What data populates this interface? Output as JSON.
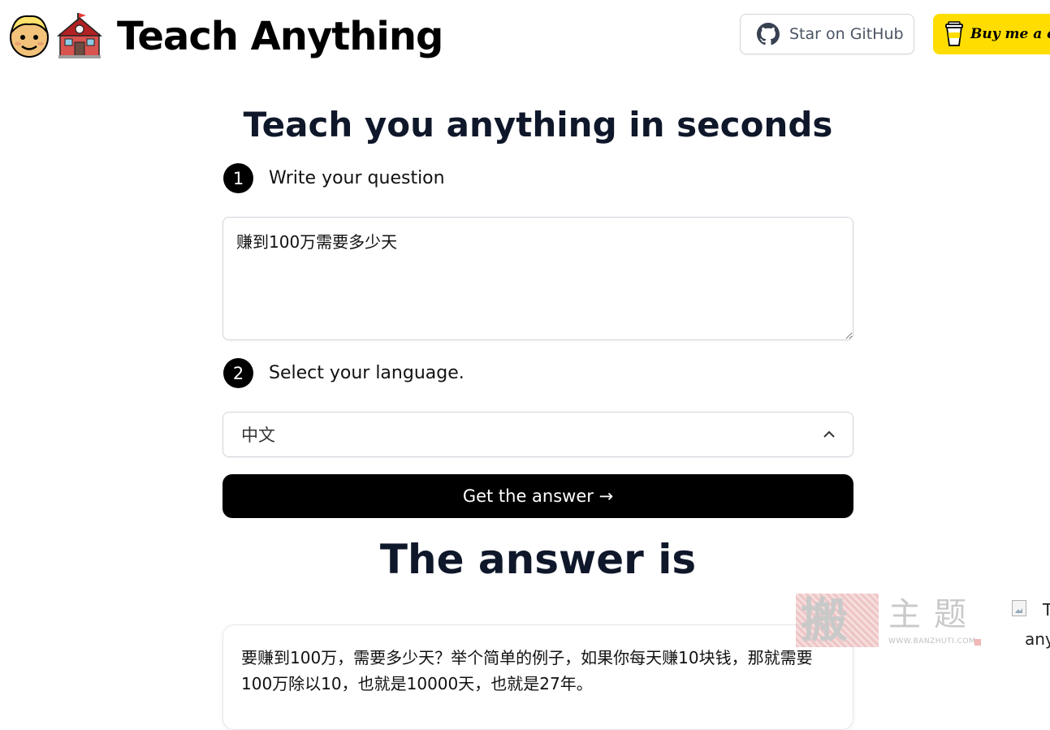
{
  "header": {
    "title": "Teach Anything",
    "github_label": "Star on GitHub",
    "coffee_label": "Buy me a coffee"
  },
  "hero": {
    "title": "Teach you anything in seconds"
  },
  "steps": [
    {
      "number": "1",
      "label": "Write your question"
    },
    {
      "number": "2",
      "label": "Select your language."
    }
  ],
  "question": {
    "value": "赚到100万需要多少天"
  },
  "language": {
    "selected": "中文"
  },
  "submit": {
    "label": "Get the answer →"
  },
  "answer": {
    "heading": "The answer is",
    "text": "要赚到100万，需要多少天？举个简单的例子，如果你每天赚10块钱，那就需要100万除以10，也就是10000天，也就是27年。"
  },
  "watermark": {
    "char1": "搬",
    "chars": "主题",
    "url": "WWW.BANZHUTI.COM"
  },
  "broken_image": {
    "alt_line1": "T",
    "alt_line2": "any"
  },
  "colors": {
    "coffee_yellow": "#ffdd00",
    "button_black": "#000000",
    "heading": "#0f172a",
    "border": "#d1d5db"
  },
  "icons": [
    "boy-emoji-icon",
    "school-emoji-icon",
    "github-icon",
    "coffee-cup-icon",
    "chevron-up-icon",
    "resize-grip-icon",
    "broken-image-icon"
  ]
}
